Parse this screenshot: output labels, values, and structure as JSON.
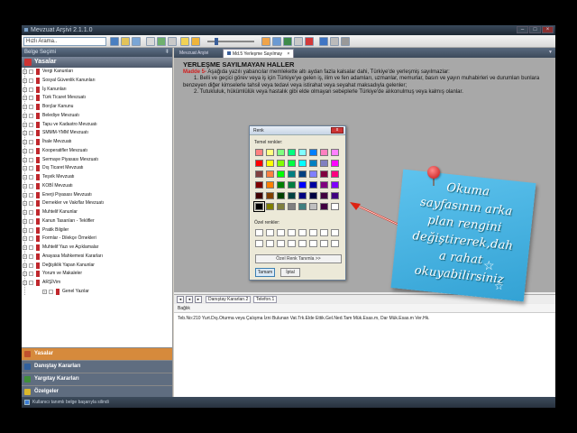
{
  "window": {
    "title": "Mevzuat Arşivi 2.1.1.0"
  },
  "toolbar": {
    "search_value": "Hızlı Arama.."
  },
  "left_panel": {
    "header": "Belge Seçimi",
    "pin": "ǂ",
    "section": "Yasalar",
    "tree": [
      {
        "label": "Vergi Kanunları",
        "level": 0
      },
      {
        "label": "Sosyal Güvenlik Kanunları",
        "level": 0
      },
      {
        "label": "İş Kanunları",
        "level": 0
      },
      {
        "label": "Türk Ticaret Mevzuatı",
        "level": 0
      },
      {
        "label": "Borçlar Kanunu",
        "level": 0
      },
      {
        "label": "Belediye Mevzuatı",
        "level": 0
      },
      {
        "label": "Tapu ve Kadastro Mevzuatı",
        "level": 0
      },
      {
        "label": "SMMM-YMM Mevzuatı",
        "level": 0
      },
      {
        "label": "İhale Mevzuatı",
        "level": 0
      },
      {
        "label": "Kooperatifler Mevzuatı",
        "level": 0
      },
      {
        "label": "Sermaye Piyasası Mevzuatı",
        "level": 0
      },
      {
        "label": "Dış Ticaret Mevzuatı",
        "level": 0
      },
      {
        "label": "Teşvik Mevzuatı",
        "level": 0
      },
      {
        "label": "KOBİ Mevzuatı",
        "level": 0
      },
      {
        "label": "Enerji Piyasası Mevzuatı",
        "level": 0
      },
      {
        "label": "Dernekler ve Vakıflar Mevzuatı",
        "level": 0
      },
      {
        "label": "Muhtelif Kanunlar",
        "level": 0
      },
      {
        "label": "Kanun Tasarıları - Teklifler",
        "level": 0
      },
      {
        "label": "Pratik Bilgiler",
        "level": 0
      },
      {
        "label": "Formlar - Dilekçe Örnekleri",
        "level": 0
      },
      {
        "label": "Muhtelif Yazı ve Açıklamalar",
        "level": 0
      },
      {
        "label": "Anayasa Mahkemesi Kararları",
        "level": 0
      },
      {
        "label": "Değişiklik Yapan Kanunlar",
        "level": 0
      },
      {
        "label": "Yorum ve Makaleler",
        "level": 0
      },
      {
        "label": "ARŞİVim",
        "level": 0
      },
      {
        "label": "Genel Yazılar",
        "level": 1
      },
      {
        "label": "kalınan yerler",
        "level": 1,
        "selected": true
      }
    ],
    "nav": [
      {
        "label": "Yasalar",
        "color": "#c0502d",
        "bg": "#d68a3c"
      },
      {
        "label": "Danıştay Kararları",
        "color": "#2f5f9c",
        "bg": "#5f6d80"
      },
      {
        "label": "Yargıtay Kararları",
        "color": "#3f8f3a",
        "bg": "#5f6d80"
      },
      {
        "label": "Özelgeler",
        "color": "#d9b72c",
        "bg": "#5f6d80"
      }
    ]
  },
  "tabs": [
    {
      "label": "Mevzuat Arşivi",
      "active": false
    },
    {
      "label": "Md.5 Yerleşme Sayılmay",
      "active": true
    }
  ],
  "tab_close": "×",
  "document": {
    "title": "YERLEŞME SAYILMAYAN HALLER",
    "madde_label": "Madde 5-",
    "madde_text": " Aşağıda yazılı yabancılar memlekette altı aydan fazla kalsalar dahi, Türkiye'de yerleşmiş sayılmazlar:",
    "p1": "1. Belli ve geçici görev veya iş için Türkiye'ye gelen iş, ilim ve fen adamları, uzmanlar, memurlar, basın ve yayın muhabirleri ve durumları bunlara benzeyen diğer kimselerle tahsil veya tedavi veya istirahat veya seyahat maksadıyla gelenler;",
    "p2": "2. Tutukluluk, hükümlülük veya hastalık gibi elde olmayan sebeplerle Türkiye'de alıkonulmuş veya kalmış olanlar."
  },
  "doc_nav": {
    "first": "◄",
    "prev": "◄",
    "next": "►",
    "tab1": "Danıştay Kararları.2",
    "tab2": "Telefon.1"
  },
  "baglik": {
    "label": "Bağlık",
    "value": "Teb.No:210 Yurt.Dış.Oturma veya Çalışma İzni Bulunan Vat.Trk.Elde Ettik.Gel.Ned.Tam Mük.Esas.m, Dar Mük.Esas.m Ver.Hk."
  },
  "status": {
    "text": "Kullanıcı tanımlı belge başarıyla silindi"
  },
  "dialog": {
    "title": "Renk",
    "close": "x",
    "basic_label": "Temel renkler:",
    "custom_label": "Özel renkler:",
    "define_button": "Özel Renk Tanımla >>",
    "ok": "Tamam",
    "cancel": "İptal",
    "basic_colors": [
      "#ff8080",
      "#ffff80",
      "#80ff80",
      "#00ff80",
      "#80ffff",
      "#0080ff",
      "#ff80c0",
      "#ff80ff",
      "#ff0000",
      "#ffff00",
      "#80ff00",
      "#00ff40",
      "#00ffff",
      "#0080c0",
      "#8080c0",
      "#ff00ff",
      "#804040",
      "#ff8040",
      "#00ff00",
      "#008080",
      "#004080",
      "#8080ff",
      "#800040",
      "#ff0080",
      "#800000",
      "#ff8000",
      "#008000",
      "#008040",
      "#0000ff",
      "#0000a0",
      "#800080",
      "#8000ff",
      "#400000",
      "#804000",
      "#004000",
      "#004040",
      "#000080",
      "#000040",
      "#400040",
      "#400080",
      "#000000",
      "#808000",
      "#808040",
      "#808080",
      "#408080",
      "#c0c0c0",
      "#400040",
      "#ffffff"
    ],
    "selected_index": 40
  },
  "note": {
    "lines": [
      "Okuma",
      "sayfasının arka",
      "plan rengini",
      "değiştirerek,dah",
      "a rahat",
      "okuyabilirsiniz"
    ]
  }
}
